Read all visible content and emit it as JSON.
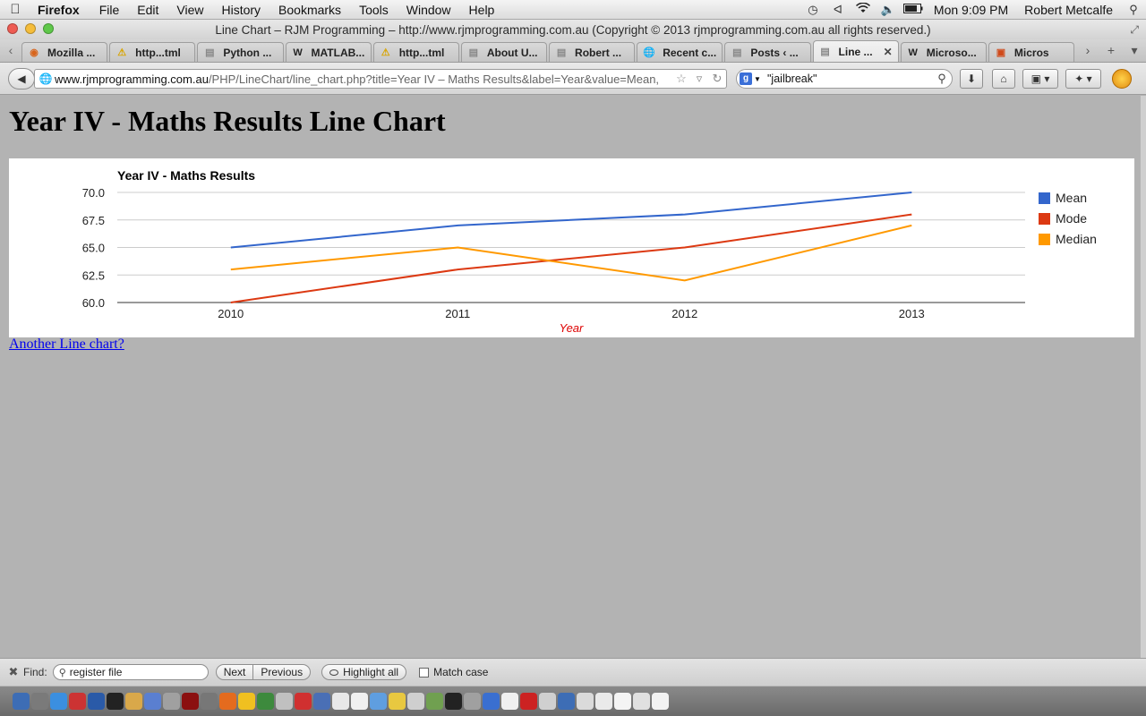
{
  "menubar": {
    "app_name": "Firefox",
    "items": [
      "File",
      "Edit",
      "View",
      "History",
      "Bookmarks",
      "Tools",
      "Window",
      "Help"
    ],
    "clock": "Mon 9:09 PM",
    "user": "Robert Metcalfe",
    "status_icons": [
      "time-machine-icon",
      "bluetooth-icon",
      "wifi-icon",
      "volume-icon",
      "battery-icon"
    ]
  },
  "window": {
    "title": "Line Chart – RJM Programming – http://www.rjmprogramming.com.au (Copyright © 2013 rjmprogramming.com.au all rights reserved.)"
  },
  "tabs": [
    {
      "label": "Mozilla ...",
      "icon": "firefox-icon"
    },
    {
      "label": "http...tml",
      "icon": "warning-icon"
    },
    {
      "label": "Python ...",
      "icon": "page-icon"
    },
    {
      "label": "MATLAB...",
      "icon": "wikipedia-icon"
    },
    {
      "label": "http...tml",
      "icon": "warning-icon"
    },
    {
      "label": "About U...",
      "icon": "page-icon"
    },
    {
      "label": "Robert ...",
      "icon": "page-icon"
    },
    {
      "label": "Recent c...",
      "icon": "globe-icon"
    },
    {
      "label": "Posts ‹ ...",
      "icon": "page-icon"
    },
    {
      "label": "Line ...",
      "icon": "page-icon",
      "active": true
    },
    {
      "label": "Microso...",
      "icon": "wikipedia-icon"
    },
    {
      "label": "Micros",
      "icon": "office-icon"
    }
  ],
  "navbar": {
    "url_host": "www.rjmprogramming.com.au",
    "url_path": "/PHP/LineChart/line_chart.php?title=Year IV – Maths Results&label=Year&value=Mean,",
    "search_value": "\"jailbreak\""
  },
  "page": {
    "heading": "Year IV - Maths Results Line Chart",
    "link_text": "Another Line chart?"
  },
  "chart_data": {
    "type": "line",
    "title": "Year IV - Maths Results",
    "xlabel": "Year",
    "ylabel": "",
    "categories": [
      "2010",
      "2011",
      "2012",
      "2013"
    ],
    "ylim": [
      60,
      70
    ],
    "yticks": [
      "70.0",
      "67.5",
      "65.0",
      "62.5",
      "60.0"
    ],
    "grid": true,
    "legend_position": "right",
    "series": [
      {
        "name": "Mean",
        "color": "#3366cc",
        "values": [
          65,
          67,
          68,
          70
        ]
      },
      {
        "name": "Mode",
        "color": "#dc3912",
        "values": [
          60,
          63,
          65,
          68
        ]
      },
      {
        "name": "Median",
        "color": "#ff9900",
        "values": [
          63,
          65,
          62,
          67
        ]
      }
    ]
  },
  "findbar": {
    "label": "Find:",
    "value": "register file",
    "next": "Next",
    "previous": "Previous",
    "highlight": "Highlight all",
    "match_case": "Match case"
  },
  "dock_colors": [
    "#3d6db5",
    "#7a7a7a",
    "#3b8fe0",
    "#c33",
    "#2a5aa8",
    "#222",
    "#d9a84a",
    "#5a7fd0",
    "#a0a0a0",
    "#8b1010",
    "#777",
    "#e46b1e",
    "#f0c020",
    "#3d8a3d",
    "#c0c0c0",
    "#d03030",
    "#4a6fb5",
    "#e8e8e8",
    "#f0f0f0",
    "#5f9ee0",
    "#e8c840",
    "#cfcfcf",
    "#70a050",
    "#222",
    "#a0a0a0",
    "#3a6fd0",
    "#f0f0f0",
    "#c22",
    "#d0d0d0",
    "#3d6db5",
    "#dadada",
    "#eaeaea",
    "#f4f4f4",
    "#e0e0e0",
    "#f2f2f2"
  ]
}
